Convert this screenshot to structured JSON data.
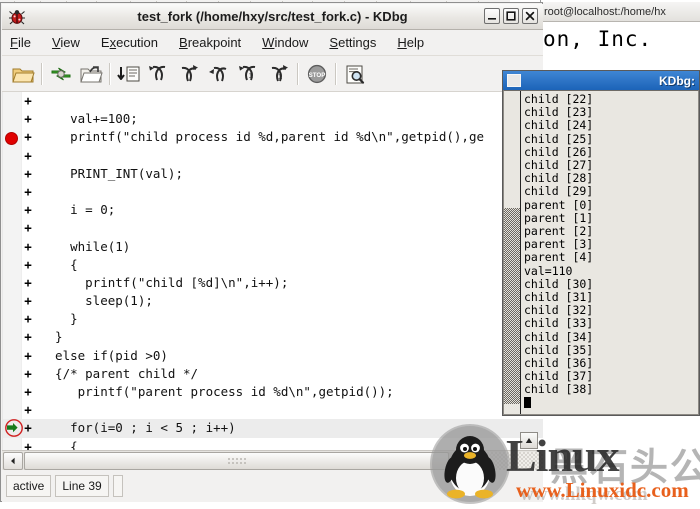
{
  "background_window": {
    "title": "root@localhost:/home/hx",
    "line1": "on, Inc.",
    "line2": ""
  },
  "main_window": {
    "title": "test_fork (/home/hxy/src/test_fork.c) - KDbg",
    "icon": "kdbg-bug-icon",
    "title_buttons": [
      {
        "name": "minimize-button",
        "glyph": "minimize-icon"
      },
      {
        "name": "maximize-button",
        "glyph": "maximize-icon"
      },
      {
        "name": "close-button",
        "glyph": "close-icon"
      }
    ],
    "menu": [
      {
        "label": "File",
        "accel": "F"
      },
      {
        "label": "View",
        "accel": "V"
      },
      {
        "label": "Execution",
        "accel": "x"
      },
      {
        "label": "Breakpoint",
        "accel": "B"
      },
      {
        "label": "Window",
        "accel": "W"
      },
      {
        "label": "Settings",
        "accel": "S"
      },
      {
        "label": "Help",
        "accel": "H"
      }
    ],
    "toolbar": [
      {
        "name": "open-folder-button",
        "icon": "open-folder-icon"
      },
      {
        "name": "separator-1",
        "icon": "separator"
      },
      {
        "name": "reload-button",
        "icon": "reload-icon"
      },
      {
        "name": "executable-button",
        "icon": "open-executable-icon"
      },
      {
        "name": "separator-2",
        "icon": "separator"
      },
      {
        "name": "run-button",
        "icon": "run-to-cursor-icon"
      },
      {
        "name": "step-into-button",
        "icon": "step-into-icon"
      },
      {
        "name": "step-over-button",
        "icon": "step-over-icon"
      },
      {
        "name": "step-out-button",
        "icon": "step-out-icon"
      },
      {
        "name": "step-into-instr-button",
        "icon": "step-into-instruction-icon"
      },
      {
        "name": "step-over-instr-button",
        "icon": "step-over-instruction-icon"
      },
      {
        "name": "separator-3",
        "icon": "separator"
      },
      {
        "name": "stop-button",
        "icon": "stop-icon"
      },
      {
        "name": "separator-4",
        "icon": "separator"
      },
      {
        "name": "find-button",
        "icon": "find-icon"
      }
    ],
    "source": {
      "marker_plus": "+",
      "lines": [
        {
          "text": "",
          "bp": false,
          "pc": false
        },
        {
          "text": "    val+=100;",
          "bp": false,
          "pc": false
        },
        {
          "text": "    printf(\"child process id %d,parent id %d\\n\",getpid(),ge",
          "bp": true,
          "pc": false
        },
        {
          "text": "",
          "bp": false,
          "pc": false
        },
        {
          "text": "    PRINT_INT(val);",
          "bp": false,
          "pc": false
        },
        {
          "text": "",
          "bp": false,
          "pc": false
        },
        {
          "text": "    i = 0;",
          "bp": false,
          "pc": false
        },
        {
          "text": "",
          "bp": false,
          "pc": false
        },
        {
          "text": "    while(1)",
          "bp": false,
          "pc": false
        },
        {
          "text": "    {",
          "bp": false,
          "pc": false
        },
        {
          "text": "      printf(\"child [%d]\\n\",i++);",
          "bp": false,
          "pc": false
        },
        {
          "text": "      sleep(1);",
          "bp": false,
          "pc": false
        },
        {
          "text": "    }",
          "bp": false,
          "pc": false
        },
        {
          "text": "  }",
          "bp": false,
          "pc": false
        },
        {
          "text": "  else if(pid >0)",
          "bp": false,
          "pc": false
        },
        {
          "text": "  {/* parent child */",
          "bp": false,
          "pc": false
        },
        {
          "text": "     printf(\"parent process id %d\\n\",getpid());",
          "bp": false,
          "pc": false
        },
        {
          "text": "",
          "bp": false,
          "pc": false
        },
        {
          "text": "    for(i=0 ; i < 5 ; i++)",
          "bp": false,
          "pc": true
        },
        {
          "text": "    {",
          "bp": false,
          "pc": false
        }
      ]
    },
    "status": {
      "state": "active",
      "line": "Line 39"
    }
  },
  "kdbg_output_window": {
    "title": "KDbg:",
    "lines": [
      "child [22]",
      "child [23]",
      "child [24]",
      "child [25]",
      "child [26]",
      "child [27]",
      "child [28]",
      "child [29]",
      "parent [0]",
      "parent [1]",
      "parent [2]",
      "parent [3]",
      "parent [4]",
      "val=110",
      "child [30]",
      "child [31]",
      "child [32]",
      "child [33]",
      "child [34]",
      "child [35]",
      "child [36]",
      "child [37]",
      "child [38]"
    ]
  },
  "watermark": {
    "brand": "Linux",
    "cn": "黑石头公社",
    "url": "www.Linuxidc.com",
    "url_ghost": "www.hkqw.com",
    "accent": "#e8601c"
  },
  "colors": {
    "titlebar_active": "#1c63b8",
    "breakpoint": "#e00000",
    "pc_arrow": "#157a1a",
    "pc_ring": "#d02020",
    "window_bg": "#f2f1f0",
    "output_bg": "#e9e7e1"
  }
}
